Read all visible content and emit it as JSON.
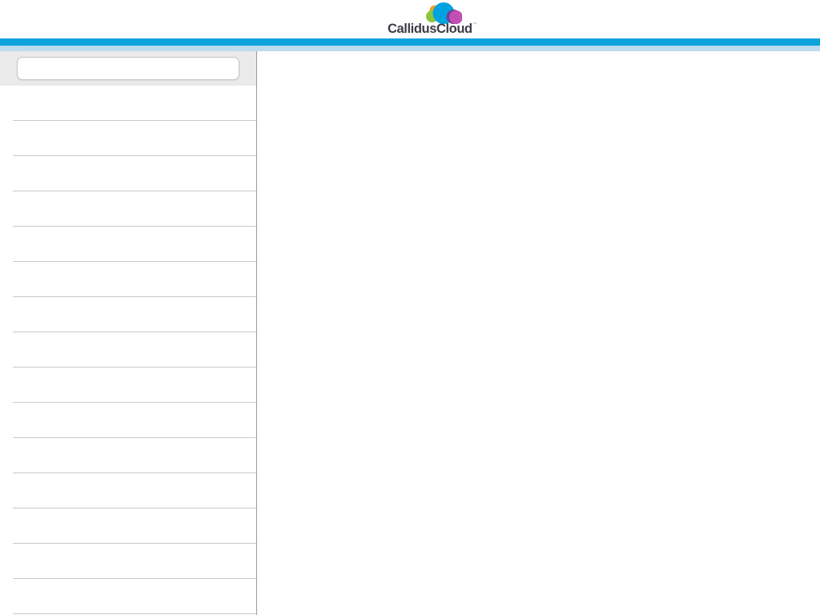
{
  "header": {
    "logo": {
      "brand": "CallidusCloud",
      "trademark": "™",
      "cloud_colors": {
        "orange": "#f7a01e",
        "green": "#8cc63f",
        "blue": "#00a3e0",
        "purple": "#703f9b",
        "magenta": "#c14fb4"
      },
      "text_color": "#3e3a45"
    },
    "accent_bar_color": "#0ba3dd",
    "accent_bar_light_color": "#bcdcee"
  },
  "sidebar": {
    "search": {
      "value": "",
      "placeholder": ""
    },
    "separator_color": "#c9c9c9",
    "search_band_color": "#eaeaea",
    "items": [
      {
        "label": ""
      },
      {
        "label": ""
      },
      {
        "label": ""
      },
      {
        "label": ""
      },
      {
        "label": ""
      },
      {
        "label": ""
      },
      {
        "label": ""
      },
      {
        "label": ""
      },
      {
        "label": ""
      },
      {
        "label": ""
      },
      {
        "label": ""
      },
      {
        "label": ""
      },
      {
        "label": ""
      },
      {
        "label": ""
      },
      {
        "label": ""
      }
    ]
  },
  "main": {
    "content": ""
  }
}
